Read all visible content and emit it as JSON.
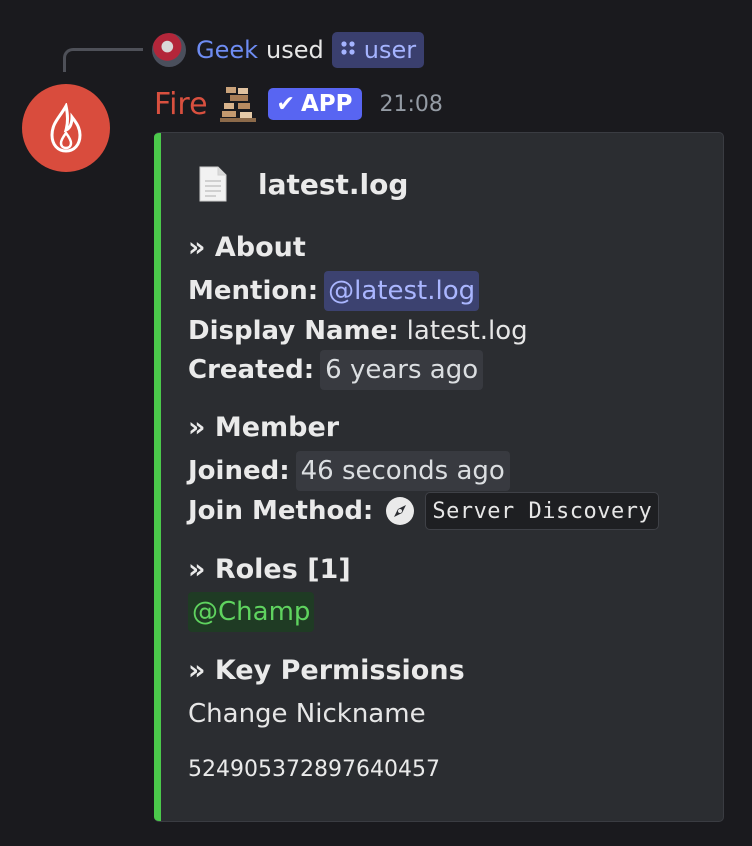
{
  "reply": {
    "username": "Geek",
    "used_text": "used",
    "command": "user",
    "command_icon": "apps-icon"
  },
  "message": {
    "author": "Fire",
    "author_color": "#d9503f",
    "badge": "APP",
    "badge_color": "#5865f2",
    "timestamp": "21:08"
  },
  "embed": {
    "accent_color": "#4bc94b",
    "title": "latest.log",
    "sections": {
      "about": {
        "heading": "» About",
        "mention_label": "Mention:",
        "mention_value": "@latest.log",
        "display_name_label": "Display Name:",
        "display_name_value": "latest.log",
        "created_label": "Created:",
        "created_value": "6 years ago"
      },
      "member": {
        "heading": "» Member",
        "joined_label": "Joined:",
        "joined_value": "46 seconds ago",
        "join_method_label": "Join Method:",
        "join_method_value": "Server Discovery"
      },
      "roles": {
        "heading": "» Roles [1]",
        "items": [
          "@Champ"
        ]
      },
      "permissions": {
        "heading": "» Key Permissions",
        "value": "Change Nickname"
      }
    },
    "footer": "524905372897640457"
  }
}
